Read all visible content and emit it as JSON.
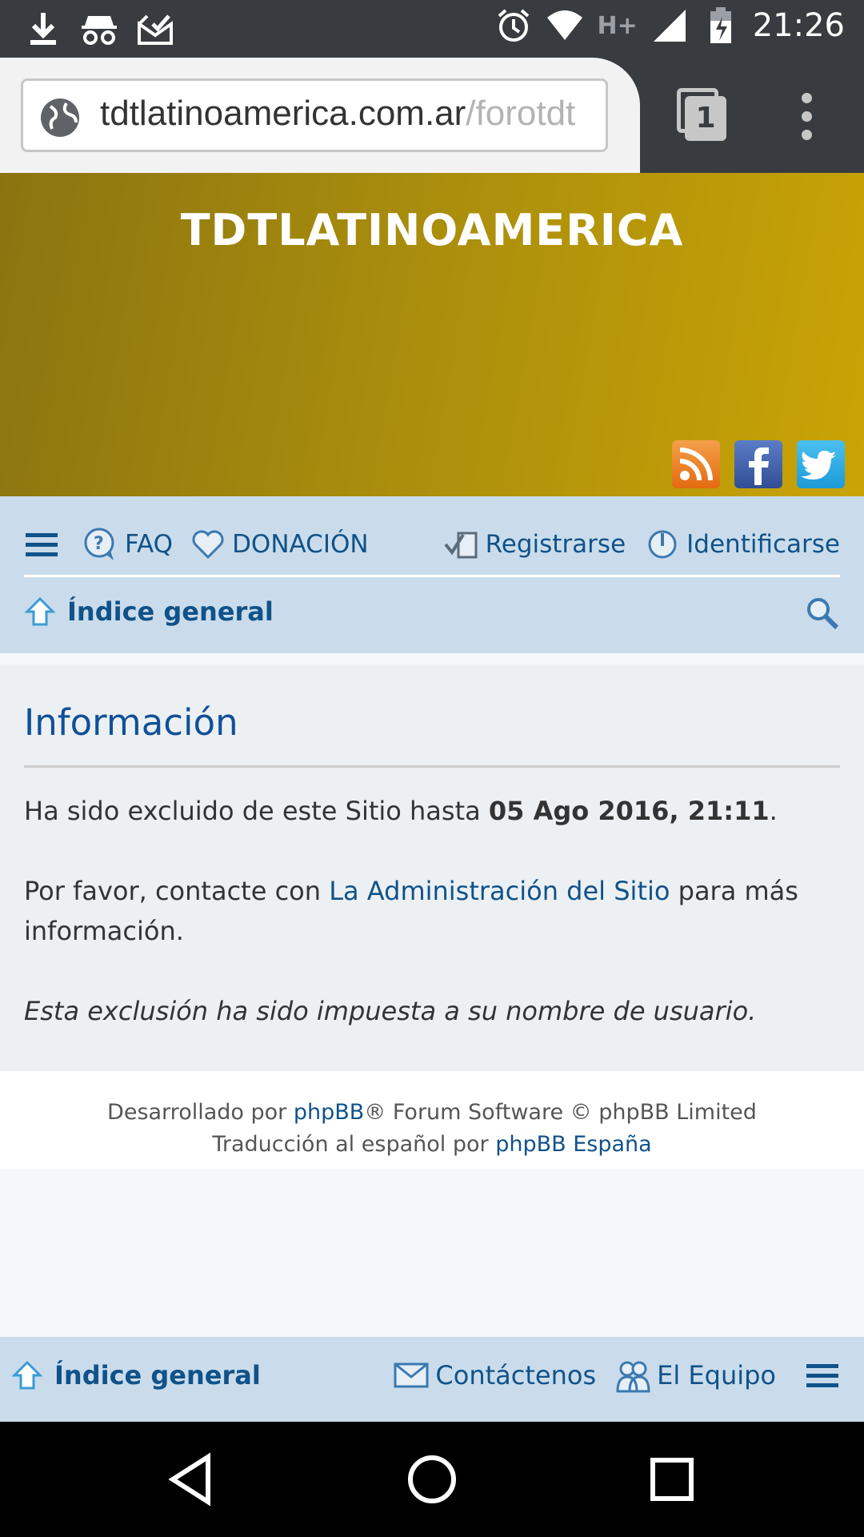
{
  "status_bar": {
    "time": "21:26",
    "network": "H+",
    "left_icons": [
      "download-icon",
      "incognito-icon",
      "mail-check-icon"
    ],
    "right_icons": [
      "alarm-icon",
      "wifi-icon",
      "signal-icon",
      "battery-charging-icon"
    ]
  },
  "browser": {
    "url_host": "tdtlatinoamerica.com.ar",
    "url_path": "/forotdt",
    "tab_count": "1"
  },
  "banner": {
    "title": "TDTLATINOAMERICA",
    "social": [
      "rss-icon",
      "facebook-icon",
      "twitter-icon"
    ],
    "colors": {
      "banner_start": "#8b7410",
      "banner_end": "#c9a405"
    }
  },
  "navbar": {
    "faq": "FAQ",
    "donation": "DONACIÓN",
    "register": "Registrarse",
    "login": "Identificarse",
    "breadcrumb": "Índice general"
  },
  "content": {
    "heading": "Información",
    "ban_prefix": "Ha sido excluido de este Sitio hasta ",
    "ban_date": "05 Ago 2016, 21:11",
    "ban_suffix": ".",
    "contact_prefix": "Por favor, contacte con ",
    "contact_link": "La Administración del Sitio",
    "contact_suffix": " para más información.",
    "note": "Esta exclusión ha sido impuesta a su nombre de usuario."
  },
  "copyright": {
    "line1_prefix": "Desarrollado por ",
    "line1_link": "phpBB",
    "line1_suffix": "® Forum Software © phpBB Limited",
    "line2_prefix": "Traducción al español por ",
    "line2_link": "phpBB España"
  },
  "footer_nav": {
    "home": "Índice general",
    "contact": "Contáctenos",
    "team": "El Equipo"
  },
  "colors": {
    "link": "#105289",
    "heading": "#115098",
    "navbar_bg": "#cadceb"
  }
}
